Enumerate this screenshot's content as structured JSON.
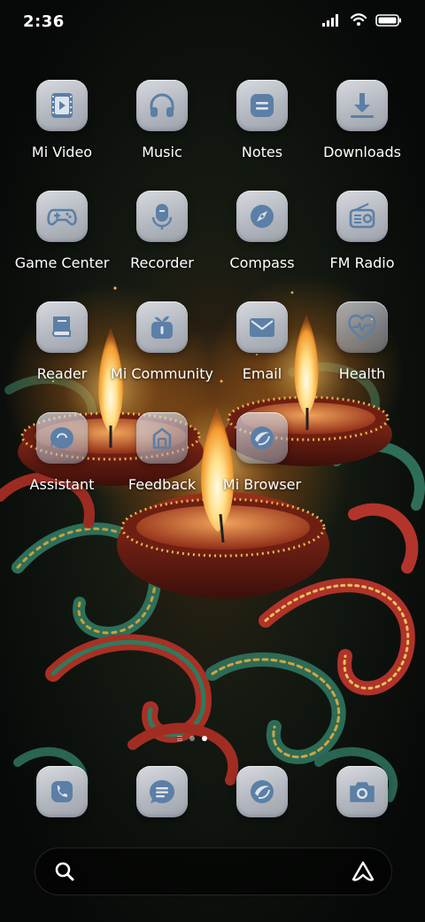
{
  "status_bar": {
    "time": "2:36",
    "icons": [
      "signal-icon",
      "wifi-icon",
      "battery-icon"
    ]
  },
  "home": {
    "apps": [
      {
        "label": "Mi Video",
        "icon": "video-icon"
      },
      {
        "label": "Music",
        "icon": "headphones-icon"
      },
      {
        "label": "Notes",
        "icon": "notes-icon"
      },
      {
        "label": "Downloads",
        "icon": "download-icon"
      },
      {
        "label": "Game Center",
        "icon": "gamepad-icon"
      },
      {
        "label": "Recorder",
        "icon": "microphone-icon"
      },
      {
        "label": "Compass",
        "icon": "compass-icon"
      },
      {
        "label": "FM Radio",
        "icon": "radio-icon"
      },
      {
        "label": "Reader",
        "icon": "book-icon"
      },
      {
        "label": "Mi Community",
        "icon": "community-icon"
      },
      {
        "label": "Email",
        "icon": "mail-icon"
      },
      {
        "label": "Health",
        "icon": "heart-pulse-icon"
      },
      {
        "label": "Assistant",
        "icon": "assistant-icon"
      },
      {
        "label": "Feedback",
        "icon": "feedback-icon"
      },
      {
        "label": "Mi Browser",
        "icon": "browser-icon"
      }
    ],
    "pages": {
      "count": 2,
      "current": 2
    }
  },
  "dock": {
    "apps": [
      {
        "icon": "phone-icon"
      },
      {
        "icon": "messages-icon"
      },
      {
        "icon": "browser-icon"
      },
      {
        "icon": "camera-icon"
      }
    ]
  },
  "search": {
    "icon": "search-icon",
    "assistant_icon": "assistant-logo-icon"
  },
  "colors": {
    "icon_tile": "#b9bdc5",
    "icon_glyph": "#5b7fa6",
    "label_text": "#ffffff"
  }
}
